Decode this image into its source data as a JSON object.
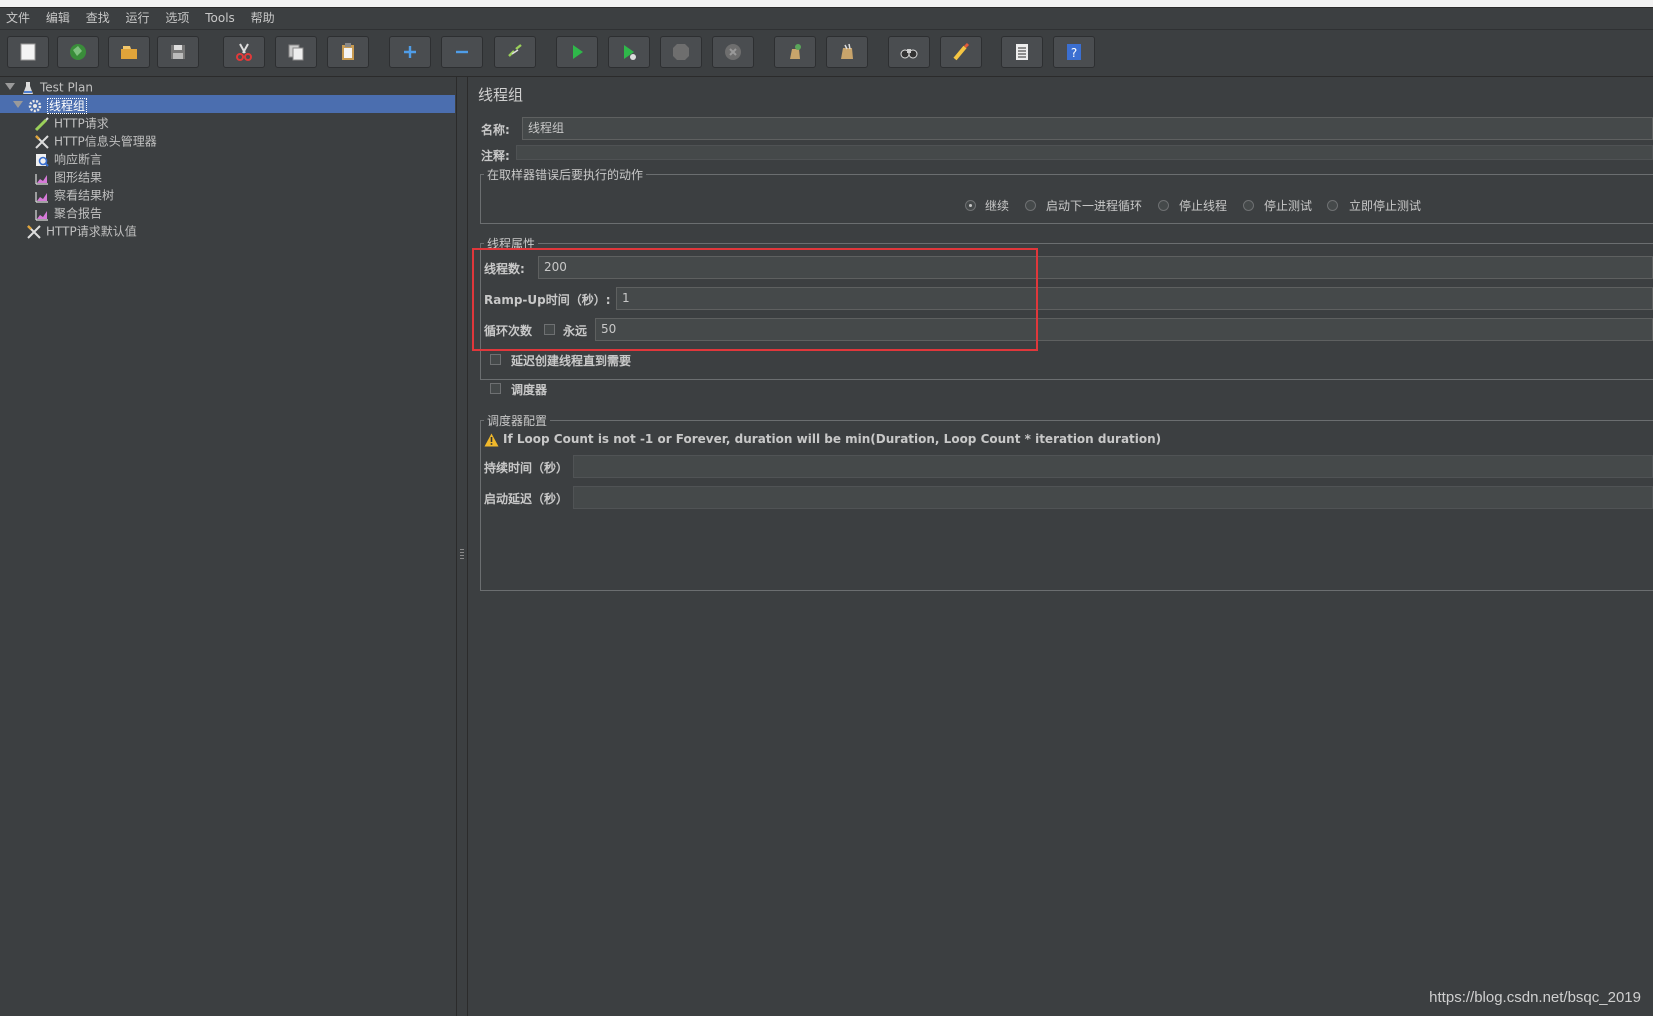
{
  "menu": [
    "文件",
    "编辑",
    "查找",
    "运行",
    "选项",
    "Tools",
    "帮助"
  ],
  "toolbar": [
    {
      "name": "new-icon"
    },
    {
      "name": "templates-icon"
    },
    {
      "name": "open-icon"
    },
    {
      "name": "save-icon"
    },
    {
      "name": "cut-icon"
    },
    {
      "name": "copy-icon"
    },
    {
      "name": "paste-icon"
    },
    {
      "name": "expand-icon"
    },
    {
      "name": "collapse-icon"
    },
    {
      "name": "toggle-icon"
    },
    {
      "name": "start-icon"
    },
    {
      "name": "start-no-pause-icon"
    },
    {
      "name": "stop-icon"
    },
    {
      "name": "shutdown-icon"
    },
    {
      "name": "clear-icon"
    },
    {
      "name": "clear-all-icon"
    },
    {
      "name": "search-icon"
    },
    {
      "name": "reset-search-icon"
    },
    {
      "name": "function-helper-icon"
    },
    {
      "name": "help-icon"
    }
  ],
  "tree": {
    "items": [
      {
        "label": "Test Plan",
        "icon": "test-plan-icon"
      },
      {
        "label": "线程组",
        "icon": "thread-group-icon"
      },
      {
        "label": "HTTP请求",
        "icon": "http-request-icon"
      },
      {
        "label": "HTTP信息头管理器",
        "icon": "header-manager-icon"
      },
      {
        "label": "响应断言",
        "icon": "assertion-icon"
      },
      {
        "label": "图形结果",
        "icon": "graph-icon"
      },
      {
        "label": "察看结果树",
        "icon": "graph-icon"
      },
      {
        "label": "聚合报告",
        "icon": "graph-icon"
      },
      {
        "label": "HTTP请求默认值",
        "icon": "header-manager-icon"
      }
    ]
  },
  "panel": {
    "title": "线程组",
    "name_label": "名称:",
    "name_value": "线程组",
    "comment_label": "注释:",
    "comment_value": "",
    "error_action": {
      "title": "在取样器错误后要执行的动作",
      "options": [
        "继续",
        "启动下一进程循环",
        "停止线程",
        "停止测试",
        "立即停止测试"
      ],
      "selected": "继续"
    },
    "thread_props": {
      "title": "线程属性",
      "threads_label": "线程数:",
      "threads_value": "200",
      "rampup_label": "Ramp-Up时间（秒）:",
      "rampup_value": "1",
      "loop_label": "循环次数",
      "forever_label": "永远",
      "forever_checked": false,
      "loop_value": "50",
      "delay_label": "延迟创建线程直到需要",
      "scheduler_label": "调度器"
    },
    "scheduler": {
      "title": "调度器配置",
      "warning": "If Loop Count is not -1 or Forever, duration will be min(Duration, Loop Count * iteration duration)",
      "duration_label": "持续时间（秒）",
      "duration_value": "",
      "delay_label": "启动延迟（秒）",
      "delay_value": ""
    }
  },
  "watermark": "https://blog.csdn.net/bsqc_2019",
  "colors": {
    "background": "#3c3f41",
    "selection": "#4b6eaf",
    "highlight": "#e0373b",
    "text": "#bbbbbb"
  }
}
